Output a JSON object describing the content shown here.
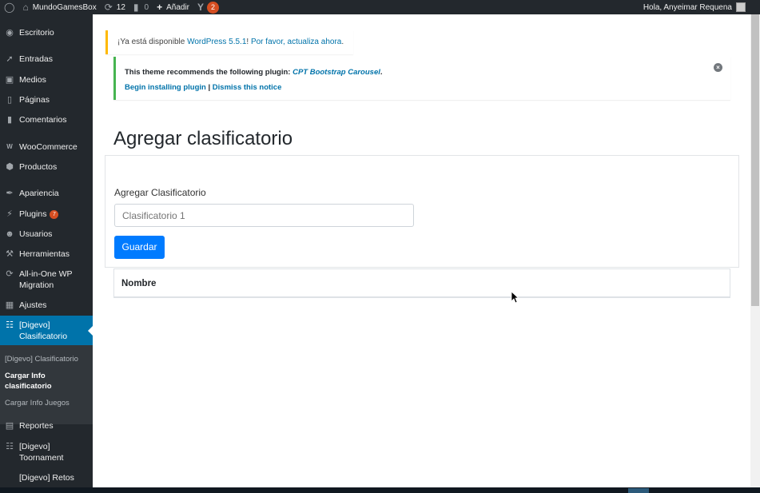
{
  "adminbar": {
    "site_name": "MundoGamesBox",
    "updates_count": "12",
    "comments_count": "0",
    "add_new_label": "Añadir",
    "yoast_badge": "2",
    "greeting": "Hola, Anyeimar Requena"
  },
  "sidebar": {
    "items": [
      {
        "label": "Escritorio",
        "icon": "dashboard-icon"
      },
      {
        "label": "Entradas",
        "icon": "pin-icon"
      },
      {
        "label": "Medios",
        "icon": "media-icon"
      },
      {
        "label": "Páginas",
        "icon": "pages-icon"
      },
      {
        "label": "Comentarios",
        "icon": "comments-icon"
      },
      {
        "label": "WooCommerce",
        "icon": "woocommerce-icon"
      },
      {
        "label": "Productos",
        "icon": "products-icon"
      },
      {
        "label": "Apariencia",
        "icon": "brush-icon"
      },
      {
        "label": "Plugins",
        "icon": "plugins-icon",
        "badge": "7"
      },
      {
        "label": "Usuarios",
        "icon": "users-icon"
      },
      {
        "label": "Herramientas",
        "icon": "wrench-icon"
      },
      {
        "label": "All-in-One WP Migration",
        "icon": "migration-icon"
      },
      {
        "label": "Ajustes",
        "icon": "settings-icon"
      },
      {
        "label": "[Digevo] Clasificatorio",
        "icon": "sitemap-icon"
      },
      {
        "label": "Reportes",
        "icon": "reports-icon"
      },
      {
        "label": "[Digevo] Toornament",
        "icon": "sitemap-icon"
      },
      {
        "label": "[Digevo] Retos",
        "icon": ""
      }
    ],
    "submenu": [
      "[Digevo] Clasificatorio",
      "Cargar Info clasificatorio",
      "Cargar Info Juegos"
    ]
  },
  "notices": {
    "update_prefix": "¡Ya está disponible ",
    "update_link": "WordPress 5.5.1",
    "update_middle": "! ",
    "update_action": "Por favor, actualiza ahora",
    "update_suffix": ".",
    "plugin_text": "This theme recommends the following plugin: ",
    "plugin_name": "CPT Bootstrap Carousel",
    "plugin_suffix": ".",
    "install_link": "Begin installing plugin",
    "separator": " | ",
    "dismiss_link": "Dismiss this notice"
  },
  "main": {
    "title": "Agregar clasificatorio",
    "field_label": "Agregar Clasificatorio",
    "input_placeholder": "Clasificatorio 1",
    "save_button": "Guardar",
    "table_header": "Nombre"
  },
  "colors": {
    "adminbar_bg": "#23282d",
    "current_menu": "#0073aa",
    "primary_button": "#007bff",
    "update_notice_border": "#ffb900",
    "plugin_notice_border": "#46b450",
    "badge": "#d54e21"
  }
}
